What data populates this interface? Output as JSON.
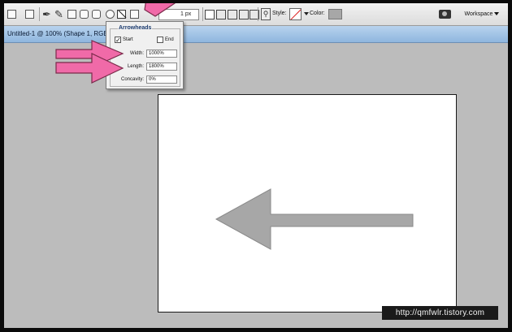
{
  "options_bar": {
    "weight_value": "1 px",
    "style_label": "Style:",
    "color_label": "Color:",
    "color_value": "#a7a7a7",
    "workspace_label": "Workspace"
  },
  "document": {
    "tab_title": "Untitled-1 @ 100% (Shape 1, RGB/8)"
  },
  "arrowheads_popup": {
    "title": "Arrowheads",
    "start_label": "Start",
    "start_checked": true,
    "end_label": "End",
    "end_checked": false,
    "width_label": "Width:",
    "width_value": "1000%",
    "length_label": "Length:",
    "length_value": "1800%",
    "concavity_label": "Concavity:",
    "concavity_value": "0%"
  },
  "canvas_shape": {
    "fill": "#a7a7a7"
  },
  "annotation_color": "#f06aa8",
  "watermark": "http://qmfwlr.tistory.com"
}
